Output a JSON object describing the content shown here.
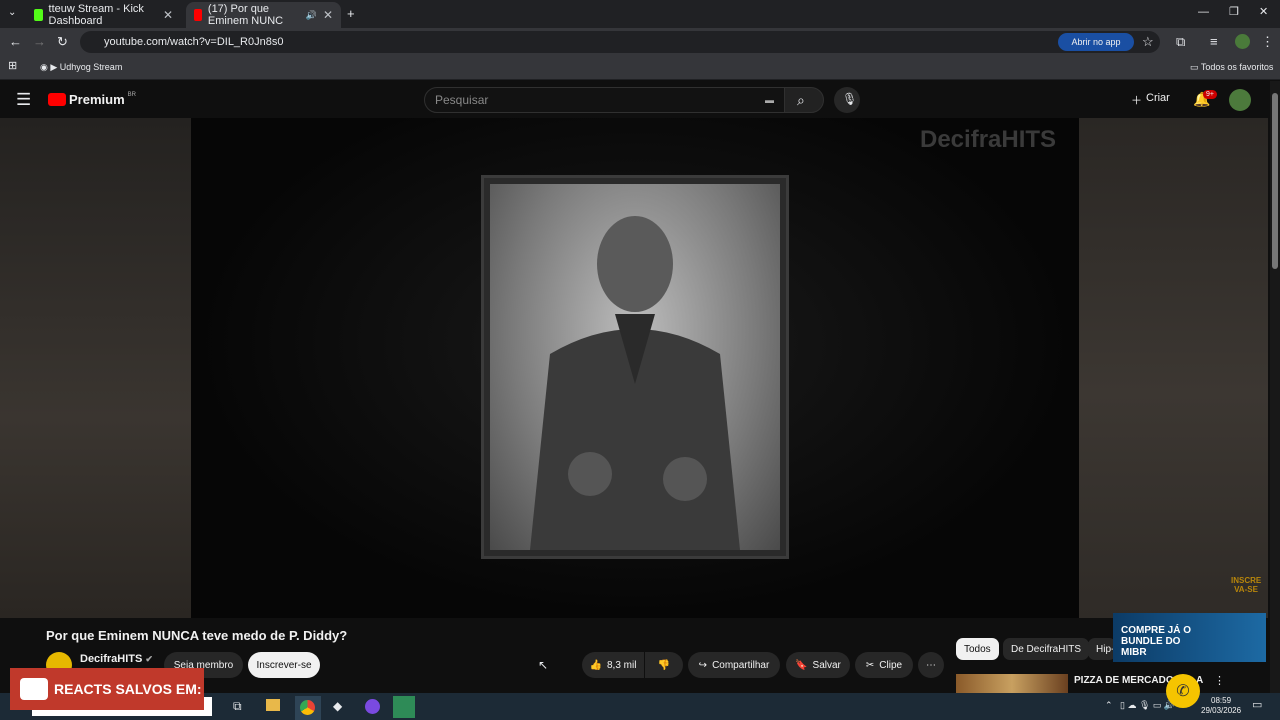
{
  "browser": {
    "tabs": [
      {
        "title": "tteuw Stream - Kick Dashboard",
        "favicon_color": "#53fc18"
      },
      {
        "title": "(17) Por que Eminem NUNC",
        "favicon_color": "#ff0000"
      }
    ],
    "url": "youtube.com/watch?v=DIL_R0Jn8s0",
    "open_in_app": "Abrir no app",
    "bookmarks": {
      "item": "Udhyog Stream",
      "all": "Todos os favoritos"
    }
  },
  "youtube": {
    "logo": "Premium",
    "region": "BR",
    "search_placeholder": "Pesquisar",
    "create_label": "Criar",
    "notifications_count": "9+"
  },
  "video": {
    "watermark": "DecifraHITS",
    "subscribe_overlay": "INSCRE VA-SE",
    "title": "Por que Eminem NUNCA teve medo de P. Diddy?",
    "channel": "DecifraHITS",
    "member_label": "Seja membro",
    "subscribe_label": "Inscrever-se",
    "likes": "8,3 mil",
    "share_label": "Compartilhar",
    "save_label": "Salvar",
    "clip_label": "Clipe"
  },
  "recommend": {
    "chips": [
      "Todos",
      "De DecifraHITS",
      "Hip-"
    ],
    "first_video_title": "PIZZA DE MERCADO IT",
    "first_video_title_tail": "A"
  },
  "overlays": {
    "react_banner": "REACTS SALVOS EM:",
    "ad_text": "COMPRE JÁ O BUNDLE DO MIBR"
  },
  "taskbar": {
    "time": "08:59",
    "date": "29/03/2026"
  }
}
